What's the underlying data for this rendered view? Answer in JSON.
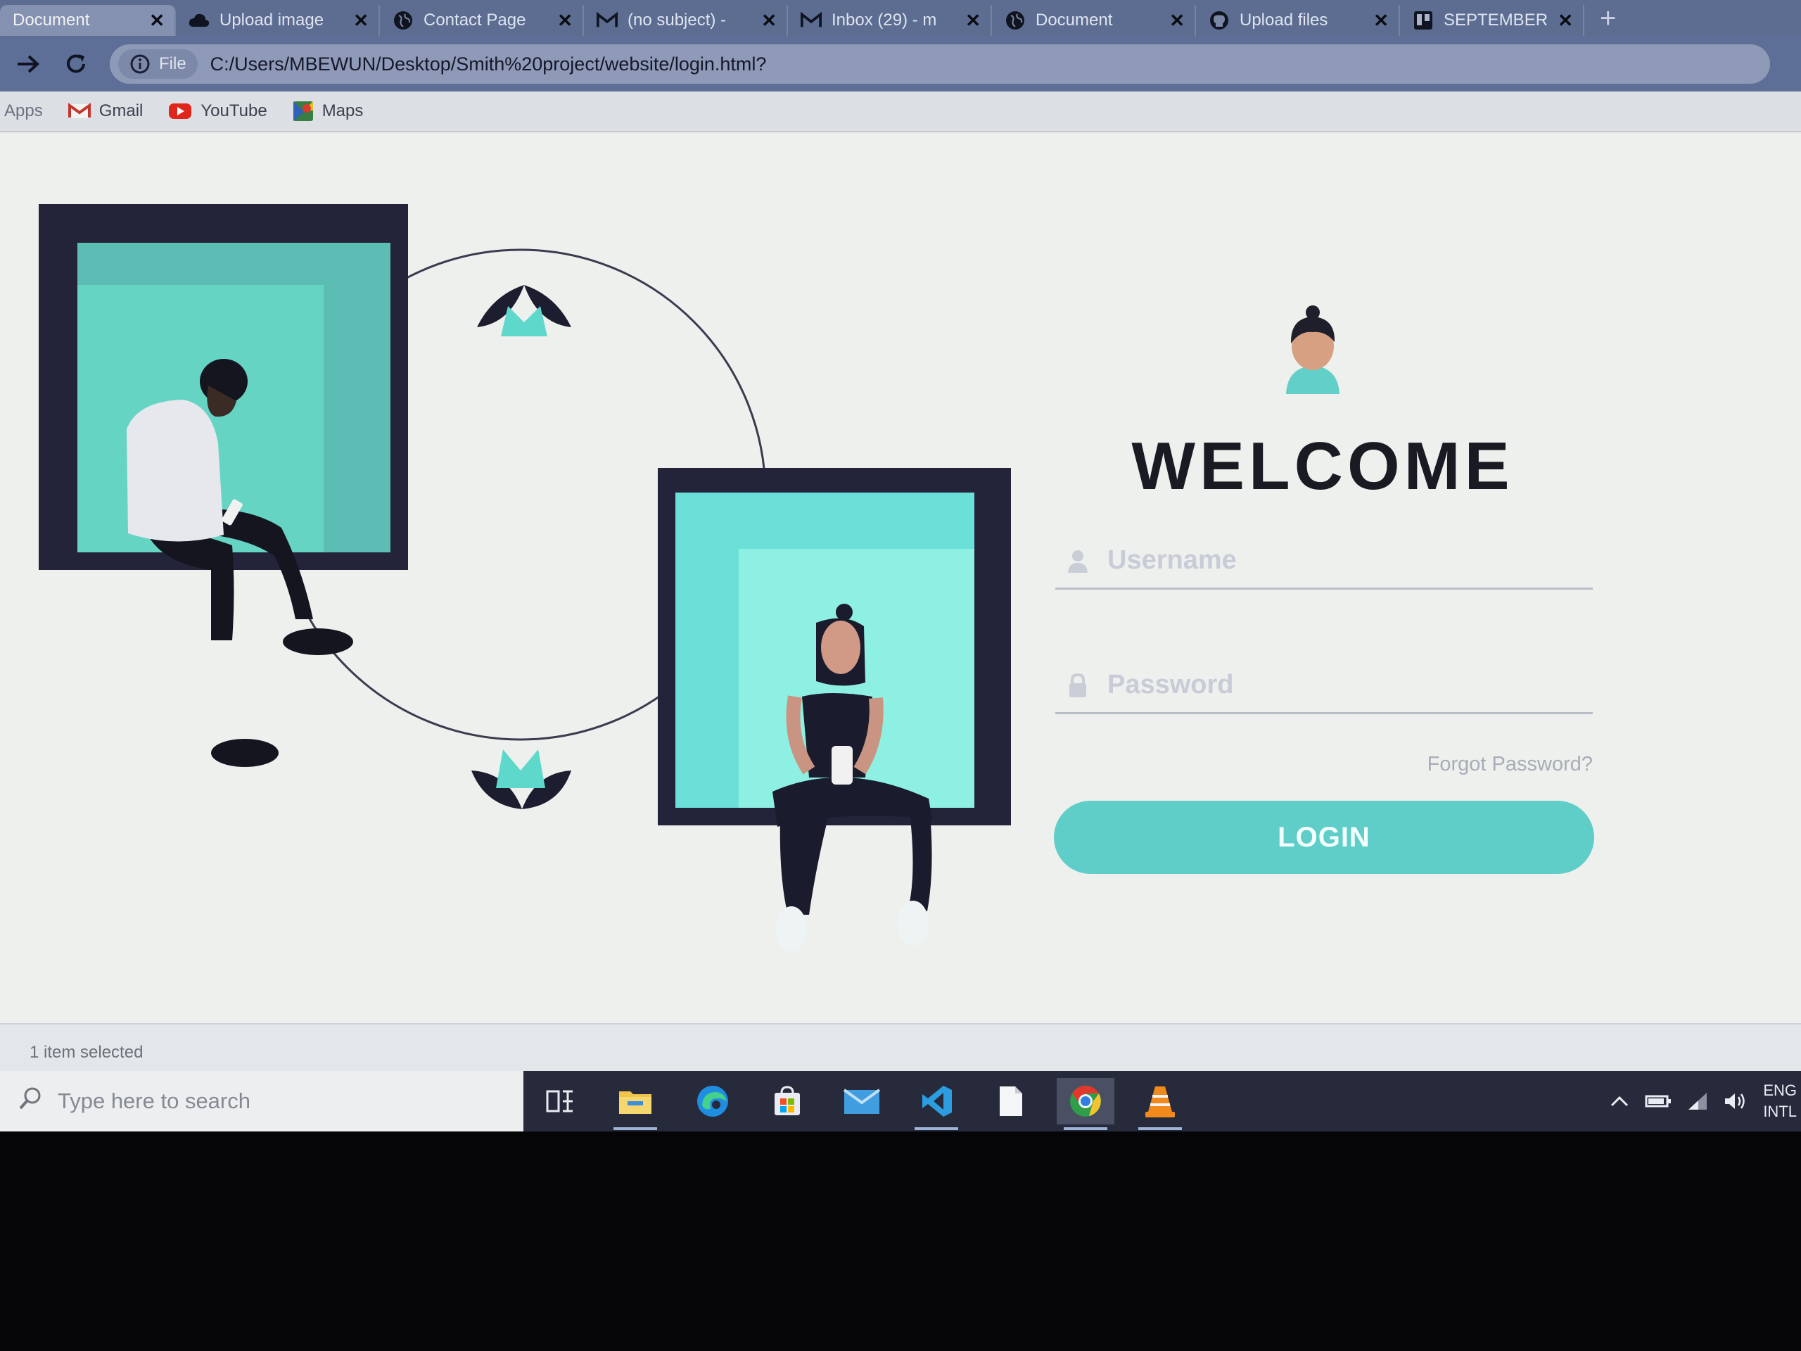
{
  "browser": {
    "tabs": [
      {
        "title": "Document",
        "icon": "globe-icon",
        "active": true
      },
      {
        "title": "Upload image",
        "icon": "cloud-icon",
        "active": false
      },
      {
        "title": "Contact Page",
        "icon": "globe-icon",
        "active": false
      },
      {
        "title": "(no subject) -",
        "icon": "gmail-icon",
        "active": false
      },
      {
        "title": "Inbox (29) - m",
        "icon": "gmail-icon",
        "active": false
      },
      {
        "title": "Document",
        "icon": "globe-icon",
        "active": false
      },
      {
        "title": "Upload files",
        "icon": "github-icon",
        "active": false
      },
      {
        "title": "SEPTEMBER",
        "icon": "trello-icon",
        "active": false
      }
    ],
    "tab_close": "✕",
    "new_tab": "+",
    "address": {
      "scheme_label": "File",
      "url": "C:/Users/MBEWUN/Desktop/Smith%20project/website/login.html?"
    },
    "bookmarks": [
      {
        "label": "Apps",
        "icon": "apps-icon"
      },
      {
        "label": "Gmail",
        "icon": "gmail-icon"
      },
      {
        "label": "YouTube",
        "icon": "youtube-icon"
      },
      {
        "label": "Maps",
        "icon": "maps-icon"
      }
    ]
  },
  "login": {
    "title": "WELCOME",
    "username_placeholder": "Username",
    "password_placeholder": "Password",
    "forgot": "Forgot Password?",
    "button": "LOGIN"
  },
  "status": {
    "text": "1 item selected"
  },
  "taskbar": {
    "search_placeholder": "Type here to search",
    "apps": [
      "task-view-icon",
      "file-explorer-icon",
      "edge-icon",
      "store-icon",
      "mail-icon",
      "vscode-icon",
      "file-icon",
      "chrome-icon",
      "vlc-icon"
    ],
    "tray_lang_1": "ENG",
    "tray_lang_2": "INTL"
  },
  "colors": {
    "teal": "#5fcdc8",
    "navy": "#2d2e47",
    "background": "#eef0ee",
    "text": "#1a1a22"
  }
}
